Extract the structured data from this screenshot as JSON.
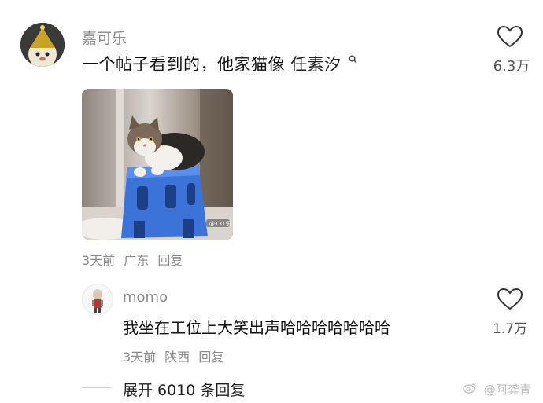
{
  "main_comment": {
    "username": "嘉可乐",
    "text": "一个帖子看到的，他家猫像",
    "mention": "任素汐",
    "likes": "6.3万",
    "date": "3天前",
    "location": "广东",
    "reply_label": "回复",
    "image_watermark": "@131乐"
  },
  "reply": {
    "username": "momo",
    "text": "我坐在工位上大笑出声哈哈哈哈哈哈哈",
    "likes": "1.7万",
    "date": "3天前",
    "location": "陕西",
    "reply_label": "回复"
  },
  "expand": {
    "label": "展开 6010 条回复"
  },
  "watermark": {
    "text": "@阿龚青"
  },
  "icons": {
    "like": "heart-outline-icon",
    "search": "search-icon",
    "weibo": "weibo-logo-icon"
  },
  "colors": {
    "meta_text": "#8b8b8b",
    "body_text": "#111111",
    "stool_blue": "#3b73d9"
  }
}
